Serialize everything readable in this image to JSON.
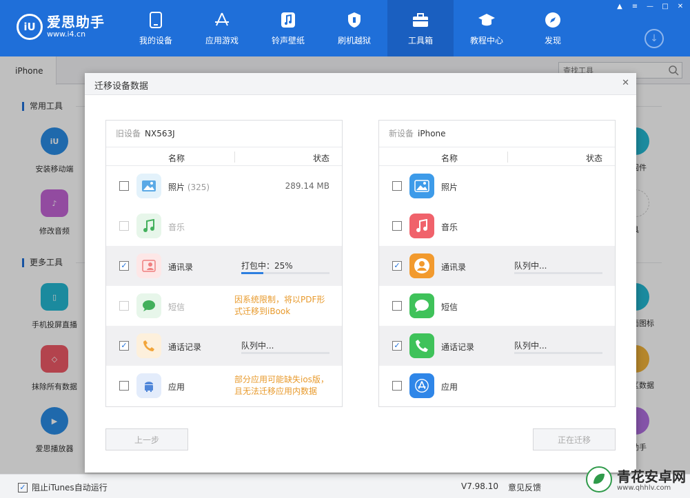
{
  "app": {
    "logo_mark": "iU",
    "logo_name": "爱思助手",
    "logo_url": "www.i4.cn",
    "nav": [
      {
        "label": "我的设备",
        "icon": "phone-icon"
      },
      {
        "label": "应用游戏",
        "icon": "app-store-icon"
      },
      {
        "label": "铃声壁纸",
        "icon": "music-icon"
      },
      {
        "label": "刷机越狱",
        "icon": "shield-icon"
      },
      {
        "label": "工具箱",
        "icon": "toolbox-icon",
        "active": true
      },
      {
        "label": "教程中心",
        "icon": "graduation-cap-icon"
      },
      {
        "label": "发现",
        "icon": "compass-icon"
      }
    ]
  },
  "tabbar": {
    "device_tab": "iPhone",
    "search_placeholder": "查找工具"
  },
  "content": {
    "section_common": "常用工具",
    "section_more": "更多工具",
    "tools": [
      {
        "label": "安装移动端",
        "color": "#2a8de6",
        "glyph": "iU"
      },
      {
        "label": "修改音频",
        "color": "#c364d6",
        "glyph": "♪"
      },
      {
        "label": "手机投屏直播",
        "color": "#25b9d3",
        "glyph": "▯"
      },
      {
        "label": "抹除所有数据",
        "color": "#ef5a67",
        "glyph": "◇"
      },
      {
        "label": "爱思播放器",
        "color": "#2a8de6",
        "glyph": "▶"
      }
    ],
    "right_tools": [
      "固件",
      "具",
      "面图标",
      "区数据",
      "助手"
    ]
  },
  "statusbar": {
    "itunes_label": "阻止iTunes自动运行",
    "version": "V7.98.10",
    "feedback": "意见反馈"
  },
  "watermark": {
    "title": "青花安卓网",
    "url": "www.qhhlv.com"
  },
  "modal": {
    "title": "迁移设备数据",
    "old_device_label": "旧设备",
    "old_device_name": "NX563J",
    "new_device_label": "新设备",
    "new_device_name": "iPhone",
    "col_name": "名称",
    "col_status": "状态",
    "old_rows": [
      {
        "name": "照片",
        "count": "(325)",
        "status": "289.14 MB",
        "checked": false,
        "disabled": false
      },
      {
        "name": "音乐",
        "checked": false,
        "disabled": true
      },
      {
        "name": "通讯录",
        "progress_text": "打包中：25%",
        "progress": 0.25,
        "checked": true,
        "highlight": true
      },
      {
        "name": "短信",
        "note": "因系统限制，将以PDF形式迁移到iBook",
        "checked": false,
        "disabled": true
      },
      {
        "name": "通话记录",
        "progress_text": "队列中...",
        "progress": 0,
        "checked": true,
        "highlight": true
      },
      {
        "name": "应用",
        "note": "部分应用可能缺失ios版，且无法迁移应用内数据",
        "checked": false
      }
    ],
    "new_rows": [
      {
        "name": "照片",
        "checked": false
      },
      {
        "name": "音乐",
        "checked": false
      },
      {
        "name": "通讯录",
        "progress_text": "队列中...",
        "progress": 0,
        "checked": true,
        "highlight": true
      },
      {
        "name": "短信",
        "checked": false
      },
      {
        "name": "通话记录",
        "progress_text": "队列中...",
        "progress": 0,
        "checked": true,
        "highlight": true
      },
      {
        "name": "应用",
        "checked": false
      }
    ],
    "prev_button": "上一步",
    "migrating_button": "正在迁移"
  }
}
